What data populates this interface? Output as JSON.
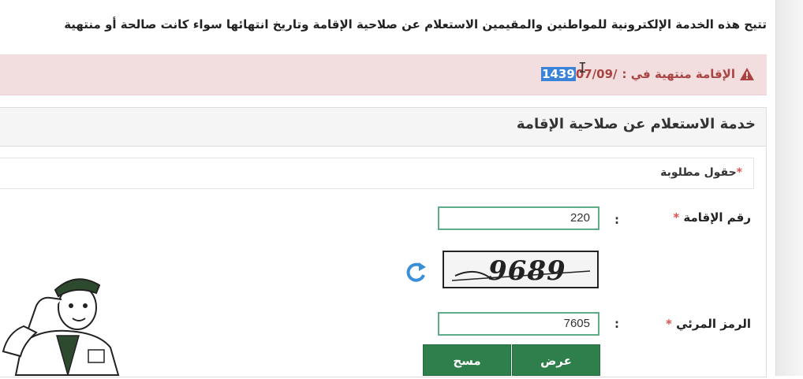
{
  "intro_text": "تتيح هذه الخدمة الإلكترونية للمواطنين والمقيمين الاستعلام عن صلاحية الإقامة وتاريخ انتهائها سواء كانت صالحة أو منتهية",
  "alert": {
    "label": "الإقامة منتهية في :",
    "date_selected": "1439",
    "date_rest": "07/09/",
    "icon": "warning-icon",
    "color": "#a94442"
  },
  "panel": {
    "title": "خدمة الاستعلام عن صلاحية الإقامة"
  },
  "required_note": "حقول مطلوبة",
  "form": {
    "iqama_label": "رقم الإقامة",
    "iqama_value": "220",
    "captcha_text": "9689",
    "visual_code_label": "الرمز المرئي",
    "visual_code_value": "7605",
    "colon": ":"
  },
  "buttons": {
    "view": "عرض",
    "clear": "مسح"
  },
  "colors": {
    "accent": "#2e7f4c",
    "input_border": "#5cae88",
    "required": "#d9534f"
  }
}
